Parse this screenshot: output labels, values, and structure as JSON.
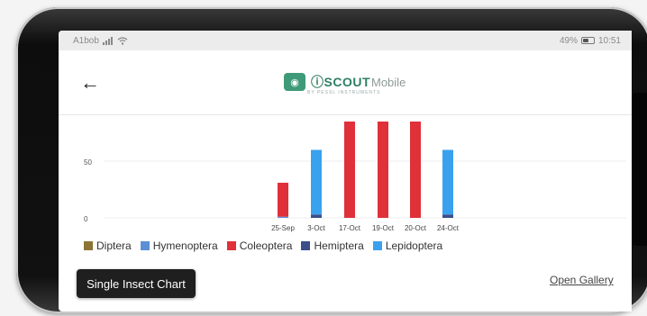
{
  "status_bar": {
    "carrier": "A1bob",
    "signal_icon": "signal-icon",
    "wifi_icon": "wifi-icon",
    "battery": "49%",
    "time": "10:51"
  },
  "header": {
    "back_icon": "back-arrow-icon",
    "logo_text": "SCOUT",
    "logo_suffix": "Mobile",
    "logo_tagline": "BY PESSL INSTRUMENTS"
  },
  "chart_data": {
    "type": "bar",
    "stacked": true,
    "categories": [
      "25-Sep",
      "3-Oct",
      "17-Oct",
      "19-Oct",
      "20-Oct",
      "24-Oct"
    ],
    "y_ticks": [
      "50",
      "0"
    ],
    "ylim": [
      0,
      85
    ],
    "series": [
      {
        "name": "Diptera",
        "color": "#8c7434",
        "values": [
          0,
          0,
          0,
          0,
          0,
          0
        ]
      },
      {
        "name": "Hymenoptera",
        "color": "#5b8fd6",
        "values": [
          1,
          0,
          0,
          0,
          0,
          0
        ]
      },
      {
        "name": "Coleoptera",
        "color": "#e0303a",
        "values": [
          30,
          0,
          85,
          85,
          85,
          0
        ]
      },
      {
        "name": "Hemiptera",
        "color": "#3b4f8a",
        "values": [
          0,
          3,
          0,
          0,
          0,
          3
        ]
      },
      {
        "name": "Lepidoptera",
        "color": "#3aa1ee",
        "values": [
          0,
          57,
          0,
          0,
          0,
          57
        ]
      }
    ],
    "grid": true,
    "legend_position": "bottom-left"
  },
  "actions": {
    "single_insect_chart": "Single Insect Chart",
    "open_gallery": "Open Gallery"
  }
}
